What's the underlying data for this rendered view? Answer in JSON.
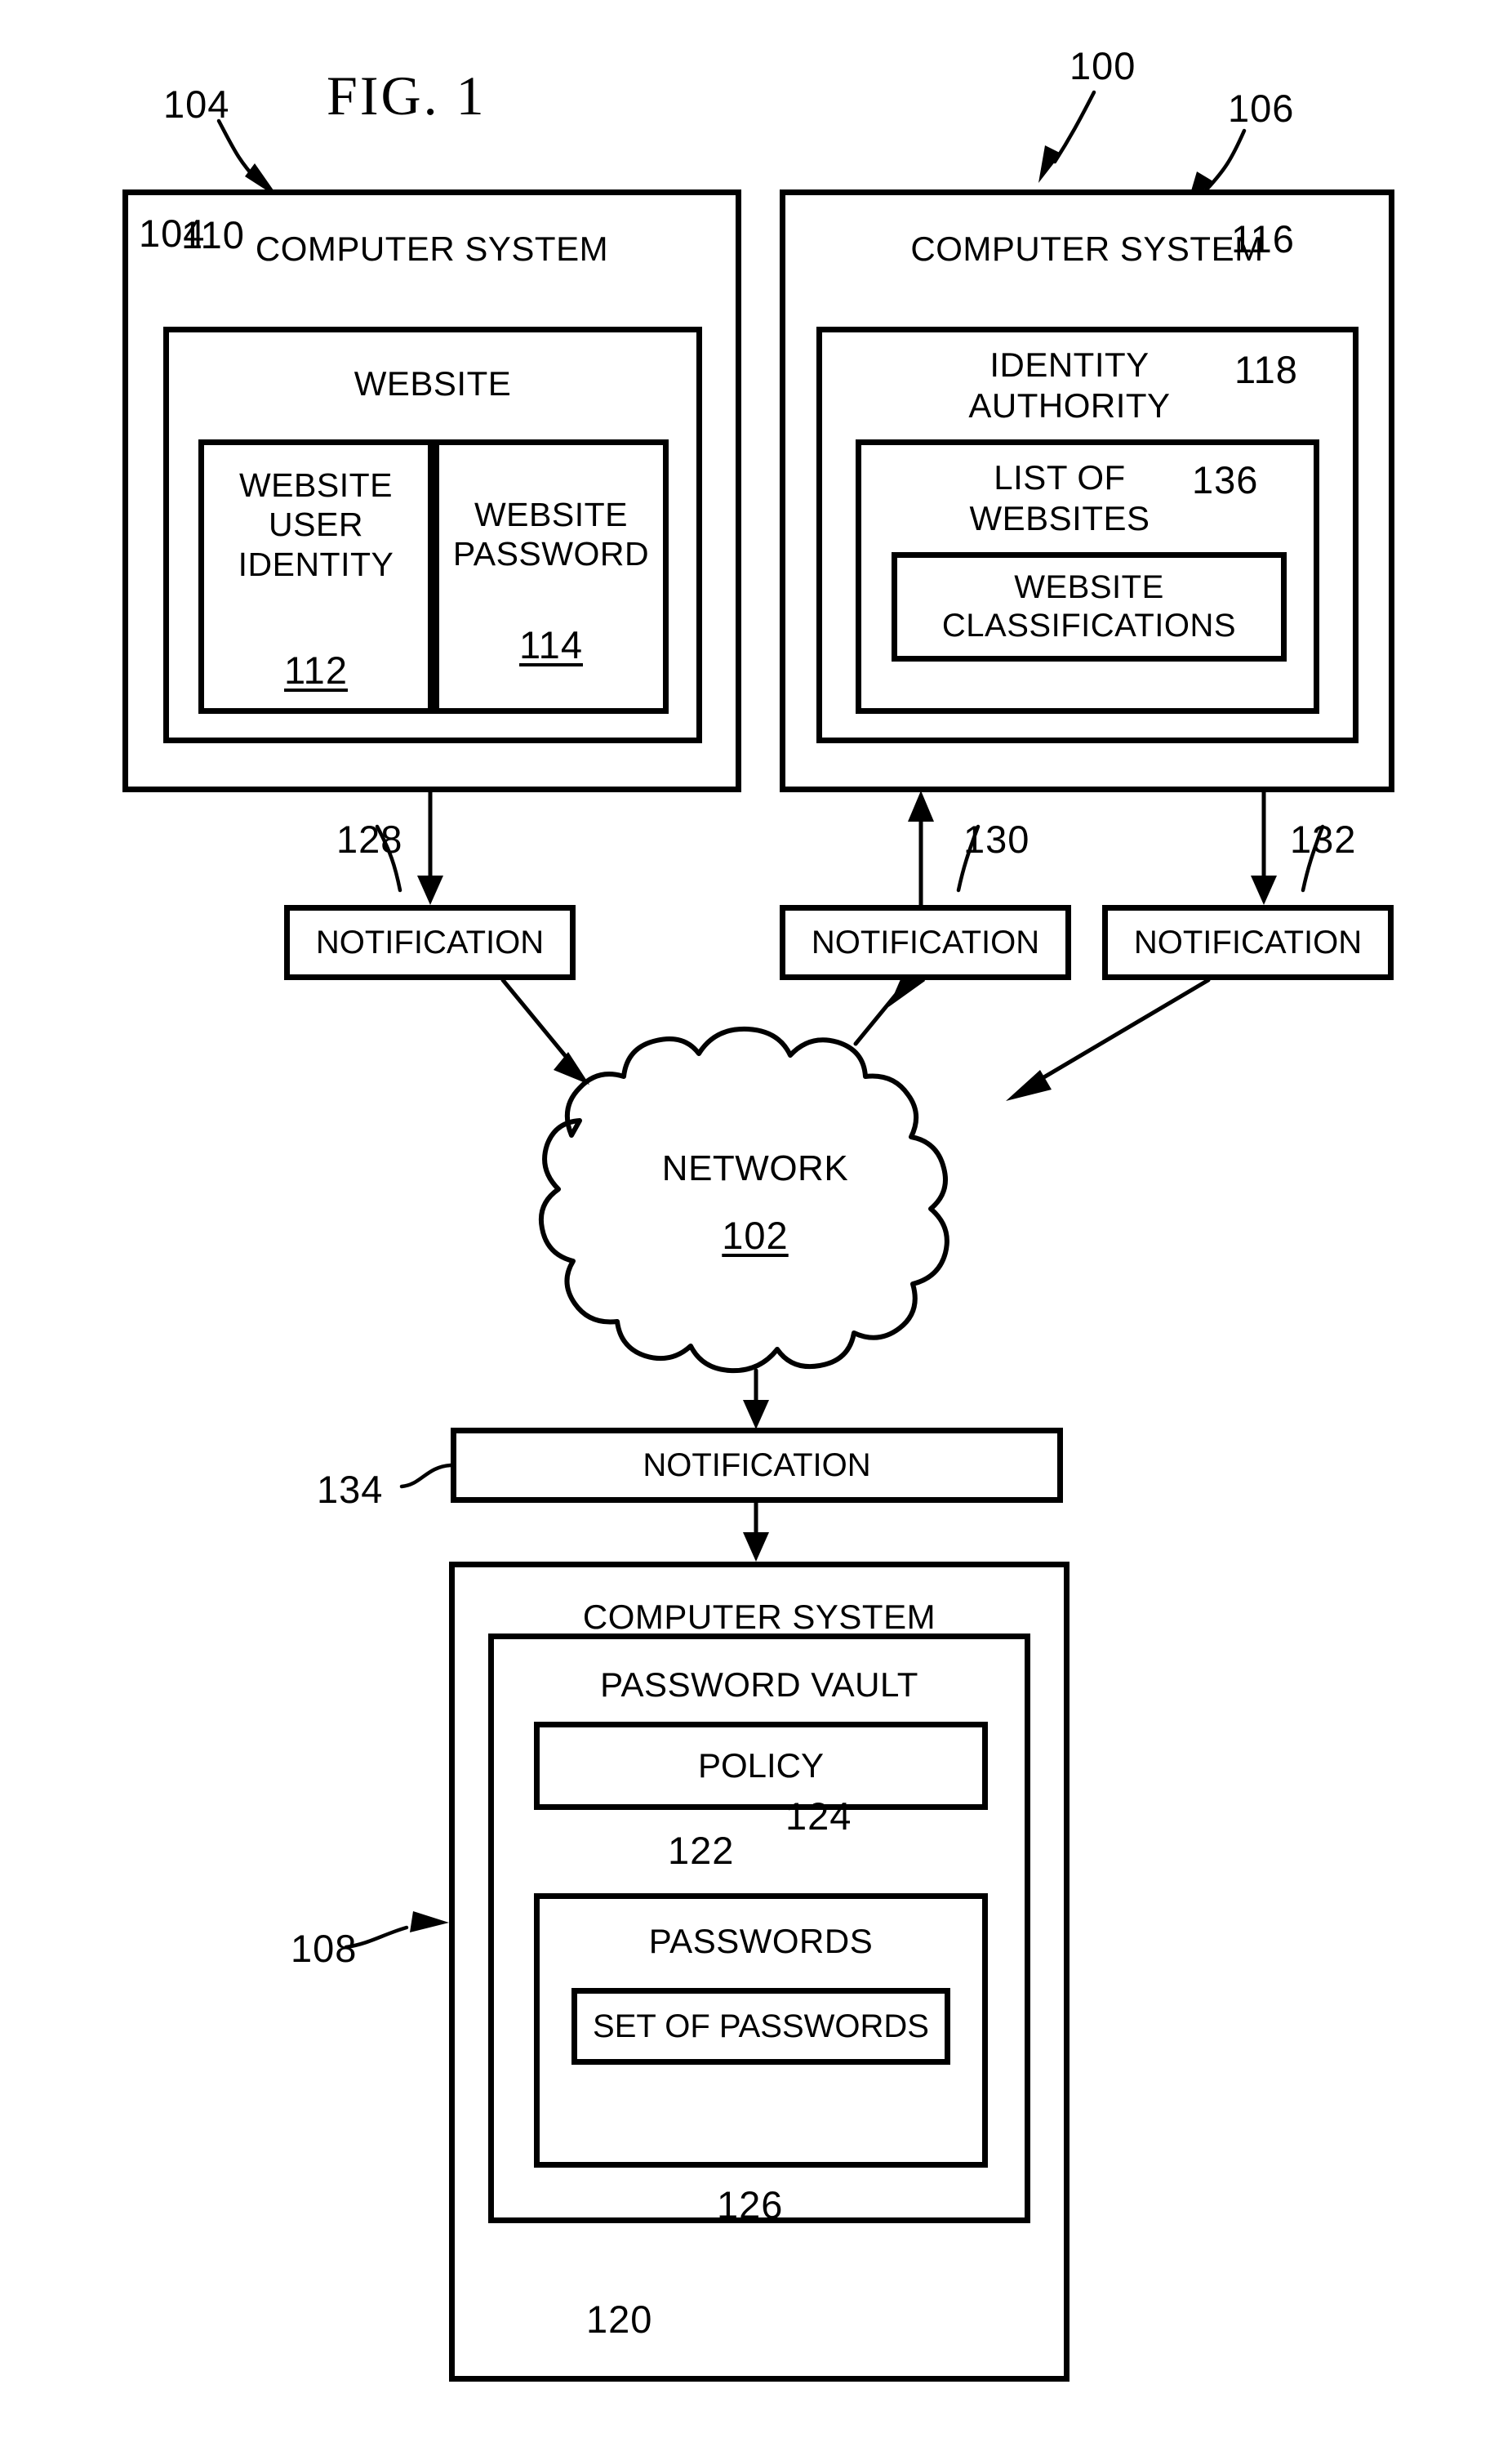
{
  "figure": {
    "title": "FIG. 1",
    "system_ref": "100",
    "network_ref_label": "NETWORK",
    "network_ref_num": "102"
  },
  "left_system": {
    "ref": "104",
    "title": "COMPUTER SYSTEM",
    "website": {
      "ref": "110",
      "title": "WEBSITE",
      "user_identity": {
        "label": "WEBSITE\nUSER\nIDENTITY",
        "ref": "112"
      },
      "password": {
        "label": "WEBSITE\nPASSWORD",
        "ref": "114"
      }
    }
  },
  "right_system": {
    "ref": "106",
    "title": "COMPUTER SYSTEM",
    "identity_authority": {
      "ref": "116",
      "title": "IDENTITY\nAUTHORITY",
      "list_of_websites": {
        "ref": "118",
        "title": "LIST OF\nWEBSITES",
        "website_classifications": {
          "ref": "136",
          "title": "WEBSITE\nCLASSIFICATIONS"
        }
      }
    }
  },
  "notifications": [
    {
      "label": "NOTIFICATION",
      "ref": "128"
    },
    {
      "label": "NOTIFICATION",
      "ref": "130"
    },
    {
      "label": "NOTIFICATION",
      "ref": "132"
    },
    {
      "label": "NOTIFICATION",
      "ref": "134"
    }
  ],
  "bottom_system": {
    "ref": "108",
    "title": "COMPUTER SYSTEM",
    "password_vault": {
      "ref": "120",
      "title": "PASSWORD VAULT",
      "policy": {
        "label": "POLICY",
        "ref": "122"
      },
      "passwords": {
        "label": "PASSWORDS",
        "ref": "124",
        "set_of_passwords": {
          "label": "SET OF PASSWORDS",
          "ref": "126"
        }
      }
    }
  },
  "colors": {
    "ink": "#000000",
    "paper": "#ffffff"
  }
}
